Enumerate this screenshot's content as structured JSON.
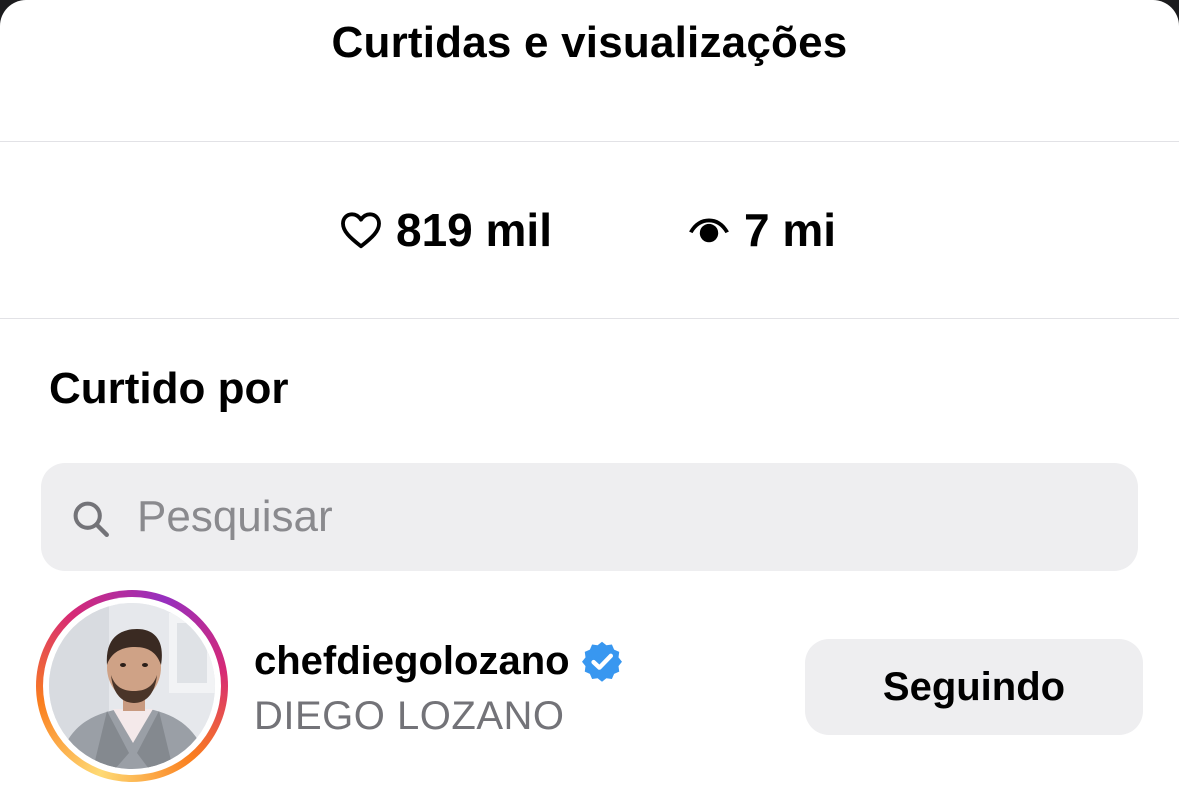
{
  "header": {
    "title": "Curtidas e visualizações"
  },
  "stats": {
    "likes": {
      "icon": "heart-icon",
      "value": "819 mil"
    },
    "views": {
      "icon": "eye-icon",
      "value": "7 mi"
    }
  },
  "liked_by": {
    "title": "Curtido por"
  },
  "search": {
    "icon": "search-icon",
    "placeholder": "Pesquisar",
    "value": ""
  },
  "users": [
    {
      "username": "chefdiegolozano",
      "full_name": "DIEGO LOZANO",
      "verified": true,
      "has_story_ring": true,
      "button_label": "Seguindo"
    }
  ],
  "colors": {
    "background": "#ffffff",
    "divider": "#e2e2e6",
    "field_background": "#eeeef0",
    "secondary_text": "#737378",
    "placeholder": "#8a8a8e",
    "verified_badge": "#3897f0"
  }
}
